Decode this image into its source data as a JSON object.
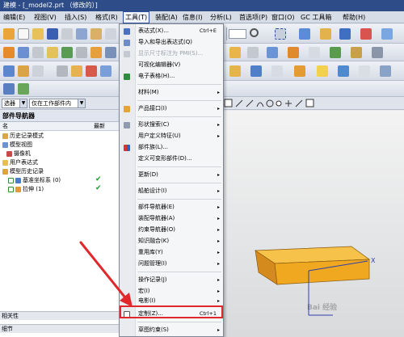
{
  "window": {
    "title": "建模 - [_model2.prt （修改的）]"
  },
  "menubar": {
    "items": [
      {
        "label": "编辑(E)"
      },
      {
        "label": "视图(V)"
      },
      {
        "label": "插入(S)"
      },
      {
        "label": "格式(R)"
      },
      {
        "label": "工具(T)"
      },
      {
        "label": "装配(A)"
      },
      {
        "label": "信息(I)"
      },
      {
        "label": "分析(L)"
      },
      {
        "label": "首选项(P)"
      },
      {
        "label": "窗口(O)"
      },
      {
        "label": "GC 工具箱"
      },
      {
        "label": "帮助(H)"
      }
    ]
  },
  "filter": {
    "type_value": "选器",
    "scope_value": "仅在工作部件内"
  },
  "navigator": {
    "title": "部件导航器",
    "header_name": "名",
    "header_latest": "最新",
    "rows": [
      {
        "label": "历史记录模式",
        "latest": ""
      },
      {
        "label": "模型视图",
        "latest": ""
      },
      {
        "label": "摄像机",
        "latest": ""
      },
      {
        "label": "用户表达式",
        "latest": ""
      },
      {
        "label": "模型历史记录",
        "latest": ""
      },
      {
        "label": "基准坐标系 (0)",
        "latest": "✔"
      },
      {
        "label": "拉伸 (1)",
        "latest": "✔"
      }
    ],
    "bottom_label_1": "相关性",
    "bottom_label_2": "细节"
  },
  "tools_menu": {
    "items": [
      {
        "label": "表达式(X)...",
        "shortcut": "Ctrl+E",
        "submenu": "",
        "disabled": false
      },
      {
        "label": "导入和导出表达式(Q)",
        "shortcut": "",
        "submenu": "",
        "disabled": false
      },
      {
        "label": "显示尺寸标注为 PMI(S)...",
        "shortcut": "",
        "submenu": "",
        "disabled": true
      },
      {
        "label": "可视化编辑器(V)",
        "shortcut": "",
        "submenu": "",
        "disabled": false
      },
      {
        "label": "电子表格(H)...",
        "shortcut": "",
        "submenu": "",
        "disabled": false
      },
      {
        "label": "材料(M)",
        "shortcut": "",
        "submenu": "▸",
        "disabled": false
      },
      {
        "label": "产品接口(I)",
        "shortcut": "",
        "submenu": "▸",
        "disabled": false
      },
      {
        "label": "形状搜索(C)",
        "shortcut": "",
        "submenu": "▸",
        "disabled": false
      },
      {
        "label": "用户定义特征(U)",
        "shortcut": "",
        "submenu": "▸",
        "disabled": false
      },
      {
        "label": "部件族(L)...",
        "shortcut": "",
        "submenu": "",
        "disabled": false
      },
      {
        "label": "定义可变形部件(D)...",
        "shortcut": "",
        "submenu": "",
        "disabled": false
      },
      {
        "label": "更新(D)",
        "shortcut": "",
        "submenu": "▸",
        "disabled": false
      },
      {
        "label": "船舶设计(I)",
        "shortcut": "",
        "submenu": "▸",
        "disabled": false
      },
      {
        "label": "部件导航器(E)",
        "shortcut": "",
        "submenu": "▸",
        "disabled": false
      },
      {
        "label": "装配导航器(A)",
        "shortcut": "",
        "submenu": "▸",
        "disabled": false
      },
      {
        "label": "约束导航器(O)",
        "shortcut": "",
        "submenu": "▸",
        "disabled": false
      },
      {
        "label": "知识融合(K)",
        "shortcut": "",
        "submenu": "▸",
        "disabled": false
      },
      {
        "label": "重用库(Y)",
        "shortcut": "",
        "submenu": "▸",
        "disabled": false
      },
      {
        "label": "问题管理(I)",
        "shortcut": "",
        "submenu": "▸",
        "disabled": false
      },
      {
        "label": "操作记录(J)",
        "shortcut": "",
        "submenu": "▸",
        "disabled": false
      },
      {
        "label": "宏(I)",
        "shortcut": "",
        "submenu": "▸",
        "disabled": false
      },
      {
        "label": "电影(I)",
        "shortcut": "",
        "submenu": "▸",
        "disabled": false
      },
      {
        "label": "定制(Z)...",
        "shortcut": "Ctrl+1",
        "submenu": "",
        "disabled": false
      },
      {
        "label": "草图约束(S)",
        "shortcut": "",
        "submenu": "▸",
        "disabled": false
      }
    ]
  },
  "watermark": "Bai 经验",
  "colors": {
    "highlight": "#e0282c",
    "block": "#f2a81e",
    "arrow": "#e0282c",
    "menu_active": "#2b4f9a"
  }
}
